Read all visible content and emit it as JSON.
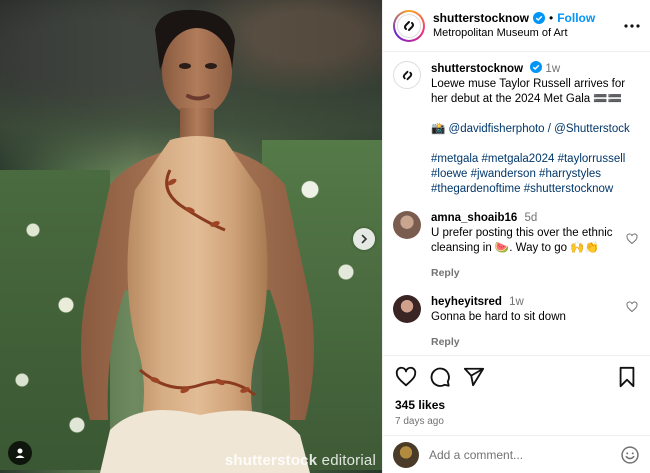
{
  "post": {
    "username": "shutterstocknow",
    "follow_label": "Follow",
    "location": "Metropolitan Museum of Art",
    "watermark_brand": "shutterstock",
    "watermark_suffix": "editorial"
  },
  "caption": {
    "username": "shutterstocknow",
    "time": "1w",
    "text": "Loewe muse Taylor Russell arrives for her debut at the 2024 Met Gala 🟰🟰",
    "credit": "📸 @davidfisherphoto / @Shutterstock",
    "hashtags": "#metgala #metgala2024 #taylorrussell #loewe #jwanderson #harrystyles #thegardenoftime #shutterstocknow"
  },
  "comments": [
    {
      "username": "amna_shoaib16",
      "time": "5d",
      "text": "U prefer posting this over the ethnic cleansing in 🍉. Way to go 🙌👏",
      "reply_label": "Reply"
    },
    {
      "username": "heyheyitsred",
      "time": "1w",
      "text": "Gonna be hard to sit down",
      "reply_label": "Reply"
    }
  ],
  "stats": {
    "likes": "345 likes",
    "posted": "7 days ago"
  },
  "composer": {
    "placeholder": "Add a comment..."
  },
  "colors": {
    "accent": "#0095f6",
    "muted": "#737373",
    "link": "#00376b"
  },
  "icons": [
    "more-icon",
    "verified-icon",
    "heart-icon",
    "comment-icon",
    "share-icon",
    "save-icon",
    "emoji-icon",
    "user-tag-icon",
    "chevron-right-icon"
  ]
}
